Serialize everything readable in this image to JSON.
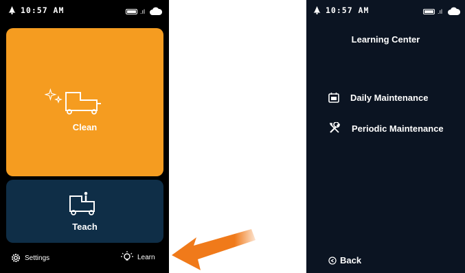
{
  "left_screen": {
    "status": {
      "time": "10:57 AM"
    },
    "clean_card": {
      "label": "Clean",
      "color": "#f59c20"
    },
    "teach_card": {
      "label": "Teach",
      "color": "#0f2e47"
    },
    "footer": {
      "settings_label": "Settings",
      "learn_label": "Learn"
    }
  },
  "right_screen": {
    "status": {
      "time": "10:57 AM"
    },
    "title": "Learning Center",
    "items": [
      {
        "label": "Daily Maintenance",
        "icon": "calendar-icon"
      },
      {
        "label": "Periodic Maintenance",
        "icon": "tools-icon"
      }
    ],
    "back_label": "Back"
  },
  "annotation": {
    "arrow_color": "#f07a1a",
    "icon": "arrow-pointer"
  }
}
